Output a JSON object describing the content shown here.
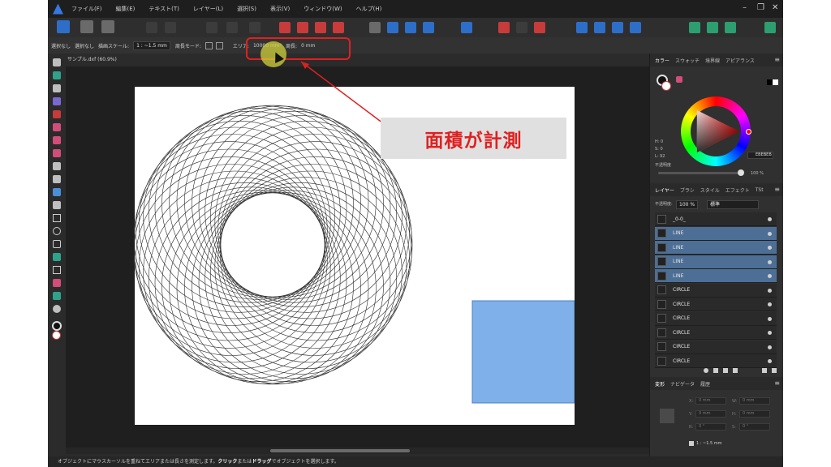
{
  "menu": {
    "items": [
      "ファイル(F)",
      "編集(E)",
      "テキスト(T)",
      "レイヤー(L)",
      "選択(S)",
      "表示(V)",
      "ウィンドウ(W)",
      "ヘルプ(H)"
    ]
  },
  "window_controls": {
    "minimize": "–",
    "restore": "❐",
    "close": "✕"
  },
  "contextbar": {
    "select_none_1": "選択なし",
    "select_none_2": "選択なし",
    "scale_label": "描画スケール:",
    "scale_value": "1 : ~1.5 mm",
    "perimeter_mode": "周長モード:",
    "area_label": "エリア:",
    "area_value": "10000 mm²",
    "length_label": "周長:",
    "length_value": "0 mm"
  },
  "document": {
    "tab_title": "サンプル.dxf (60.9%)"
  },
  "annotation": {
    "label": "面積が計測"
  },
  "status": {
    "text_1": "オブジェクトにマウスカーソルを重ねてエリアまたは長さを測定します。",
    "bold_1": "クリック",
    "text_2": "または",
    "bold_2": "ドラッグ",
    "text_3": "でオブジェクトを選択します。"
  },
  "color_panel": {
    "tabs": [
      "カラー",
      "スウォッチ",
      "境界線",
      "アピアランス"
    ],
    "h": "H: 0",
    "s": "S: 0",
    "l": "L: 92",
    "hex": "EBEBEB",
    "opacity_label": "不透明度",
    "opacity_value": "100 %",
    "opacity_fraction": 1.0
  },
  "layers_panel": {
    "tabs": [
      "レイヤー",
      "ブラシ",
      "スタイル",
      "エフェクト",
      "TSt"
    ],
    "opacity_label": "不透明度:",
    "opacity_value": "100 %",
    "blend_mode": "標準",
    "rows": [
      {
        "name": "_0-0_",
        "selected": false
      },
      {
        "name": "LINE",
        "selected": true
      },
      {
        "name": "LINE",
        "selected": true
      },
      {
        "name": "LINE",
        "selected": true
      },
      {
        "name": "LINE",
        "selected": true
      },
      {
        "name": "CIRCLE",
        "selected": false
      },
      {
        "name": "CIRCLE",
        "selected": false
      },
      {
        "name": "CIRCLE",
        "selected": false
      },
      {
        "name": "CIRCLE",
        "selected": false
      },
      {
        "name": "CIRCLE",
        "selected": false
      },
      {
        "name": "CIRCLE",
        "selected": false
      }
    ]
  },
  "transform_panel": {
    "tabs": [
      "変形",
      "ナビゲータ",
      "履歴"
    ],
    "x_label": "X:",
    "x_value": "0 mm",
    "w_label": "W:",
    "w_value": "0 mm",
    "y_label": "Y:",
    "y_value": "0 mm",
    "h_label": "H:",
    "h_value": "0 mm",
    "r_label": "R:",
    "r_value": "0 °",
    "s_label": "S:",
    "s_value": "0 °",
    "scale_value": "1 : ~1.5 mm"
  },
  "colors": {
    "accent": "#2d6ec9",
    "annotation_red": "#e02020",
    "measured_square": "#7fb0ea",
    "selected_row": "#4d6f96"
  }
}
